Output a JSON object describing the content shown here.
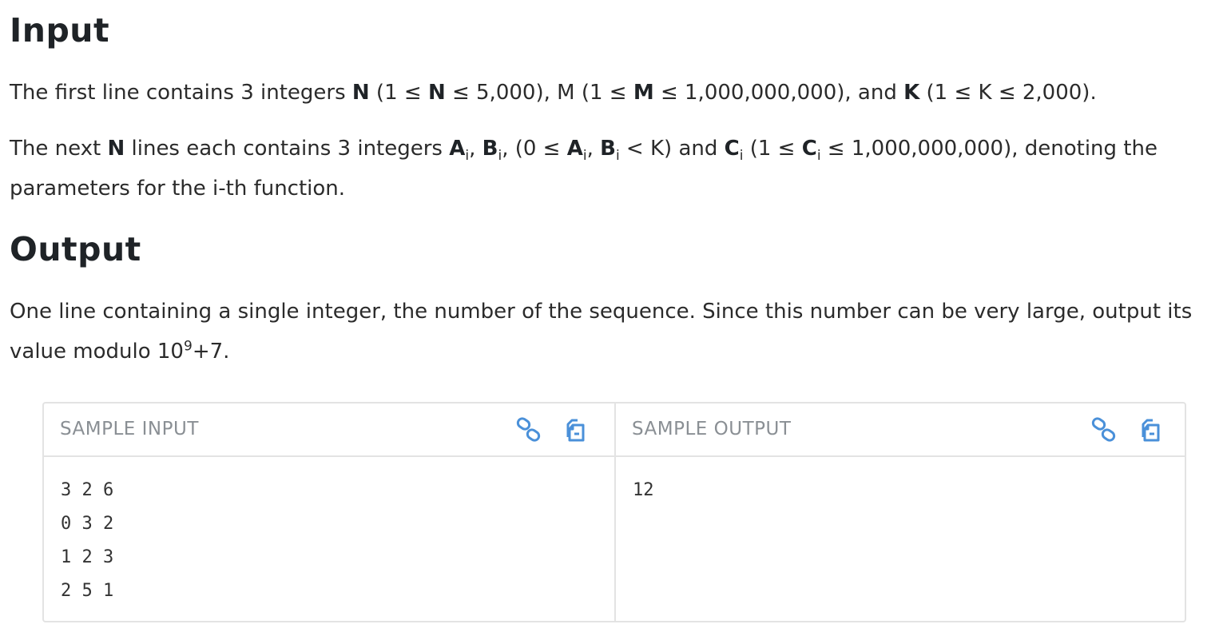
{
  "input_section": {
    "heading": "Input",
    "p1": {
      "a": "The first line contains 3 integers ",
      "n": "N",
      "b": " (1 ≤ ",
      "n2": "N",
      "c": " ≤ 5,000), M (1 ≤ ",
      "m": "M",
      "d": " ≤ 1,000,000,000), and ",
      "k": "K",
      "e": " (1 ≤ K ≤ 2,000)."
    },
    "p2": {
      "a": "The next ",
      "n": "N",
      "b": " lines each contains 3 integers ",
      "A": "A",
      "i": "i",
      "c": ", ",
      "B": "B",
      "d": ", (0 ≤ ",
      "e": ", ",
      "f": " < K) and ",
      "C": "C",
      "g": " (1 ≤ ",
      "h": " ≤ 1,000,000,000), denoting the",
      "line2": "parameters for the i-th function."
    }
  },
  "output_section": {
    "heading": "Output",
    "line1": "One line containing a single integer, the number of the sequence. Since this number can be very large, output its",
    "line2a": "value modulo 10",
    "exp": "9",
    "line2b": "+7."
  },
  "samples": {
    "input_title": "SAMPLE INPUT",
    "output_title": "SAMPLE OUTPUT",
    "input_text": "3 2 6\n0 3 2\n1 2 3\n2 5 1",
    "output_text": "12",
    "icons": {
      "link": "link-icon",
      "copy": "copy-icon"
    },
    "accent": "#4a90d9"
  }
}
